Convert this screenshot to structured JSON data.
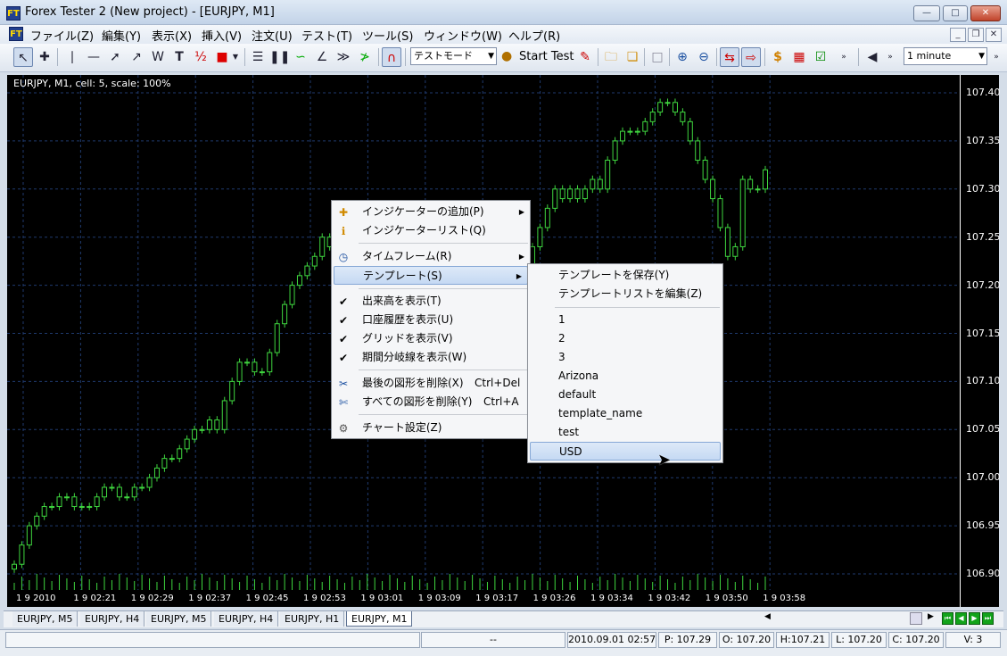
{
  "window": {
    "title": "Forex Tester 2  (New project) - [EURJPY, M1]",
    "app_icon": "FT",
    "controls": [
      "minimize-icon",
      "maximize-icon",
      "close-icon"
    ]
  },
  "menu": [
    "ファイル(Z)",
    "編集(Y)",
    "表示(X)",
    "挿入(V)",
    "注文(U)",
    "テスト(T)",
    "ツール(S)",
    "ウィンドウ(W)",
    "ヘルプ(R)"
  ],
  "toolbar": {
    "mode_select": "テストモード",
    "start_test": "Start Test",
    "timeframe_select": "1 minute"
  },
  "chart": {
    "label": "EURJPY, M1, cell: 5, scale: 100%",
    "price_ticks": [
      "107.40",
      "107.35",
      "107.30",
      "107.25",
      "107.20",
      "107.15",
      "107.10",
      "107.05",
      "107.00",
      "106.95",
      "106.90"
    ],
    "time_ticks": [
      "1 9 2010",
      "1 9 02:21",
      "1 9 02:29",
      "1 9 02:37",
      "1 9 02:45",
      "1 9 02:53",
      "1 9 03:01",
      "1 9 03:09",
      "1 9 03:17",
      "1 9 03:26",
      "1 9 03:34",
      "1 9 03:42",
      "1 9 03:50",
      "1 9 03:58"
    ],
    "candle_color": "#3fd63f",
    "grid_color": "#1f3a6e",
    "background": "#000000"
  },
  "context_menu": {
    "items": [
      {
        "label": "インジケーターの追加(P)",
        "icon": "add-indicator-icon",
        "submenu": true
      },
      {
        "label": "インジケーターリスト(Q)",
        "icon": "indicator-list-icon"
      },
      {
        "label": "タイムフレーム(R)",
        "icon": "clock-icon",
        "submenu": true
      },
      {
        "label": "テンプレート(S)",
        "submenu": true
      },
      {
        "label": "出来高を表示(T)",
        "checked": true
      },
      {
        "label": "口座履歴を表示(U)",
        "checked": true
      },
      {
        "label": "グリッドを表示(V)",
        "checked": true
      },
      {
        "label": "期間分岐線を表示(W)",
        "checked": true
      },
      {
        "label": "最後の図形を削除(X)",
        "shortcut": "Ctrl+Del",
        "icon": "delete-object-icon"
      },
      {
        "label": "すべての図形を削除(Y)",
        "shortcut": "Ctrl+A",
        "icon": "delete-all-objects-icon"
      },
      {
        "label": "チャート設定(Z)",
        "icon": "chart-settings-icon"
      }
    ]
  },
  "template_submenu": {
    "save": "テンプレートを保存(Y)",
    "edit": "テンプレートリストを編集(Z)",
    "templates": [
      "1",
      "2",
      "3",
      "Arizona",
      "default",
      "template_name",
      "test",
      "USD"
    ],
    "highlighted": "USD"
  },
  "tabs": [
    "EURJPY, M5",
    "EURJPY, H4",
    "EURJPY, M5",
    "EURJPY, H4",
    "EURJPY, H1",
    "EURJPY, M1"
  ],
  "active_tab": "EURJPY, M1",
  "status": {
    "empty": "--",
    "datetime": "2010.09.01 02:57",
    "p": "P: 107.29",
    "o": "O: 107.20",
    "h": "H:107.21",
    "l": "L: 107.20",
    "c": "C: 107.20",
    "v": "V: 3"
  }
}
